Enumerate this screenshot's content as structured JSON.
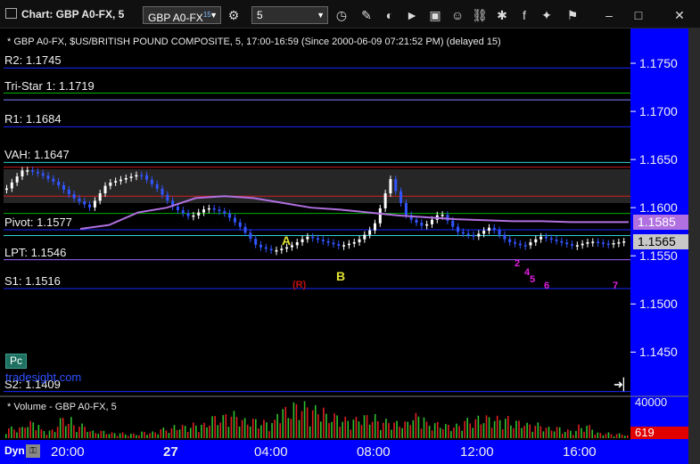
{
  "window": {
    "title": "Chart: GBP A0-FX, 5"
  },
  "toolbar": {
    "symbol": "GBP A0-FX",
    "symbol_sup": "15",
    "interval": "5"
  },
  "chart_header": "* GBP A0-FX, $US/BRITISH POUND COMPOSITE, 5, 17:00-16:59 (Since 2000-06-09 07:21:52 PM) (delayed 15)",
  "volume_header": "* Volume - GBP A0-FX, 5",
  "watermark": "tradesight.com",
  "pc_button": "Pc",
  "dyn_label": "Dyn",
  "colors": {
    "axis_bg": "#0000ff",
    "up": "#ffffff",
    "down": "#3355ff",
    "vwap": "#b070e0"
  },
  "chart_data": [
    {
      "type": "line",
      "ylim": [
        1.1405,
        1.1775
      ],
      "y_ticks": [
        "1.1750",
        "1.1700",
        "1.1650",
        "1.1600",
        "1.1550",
        "1.1500",
        "1.1450"
      ],
      "x_ticks": [
        "20:00",
        "27",
        "04:00",
        "08:00",
        "12:00",
        "16:00"
      ],
      "series": [
        {
          "values": [
            1.162,
            1.164,
            1.1635,
            1.1625,
            1.161,
            1.16,
            1.1625,
            1.163,
            1.1635,
            1.162,
            1.16,
            1.159,
            1.16,
            1.1595,
            1.158,
            1.156,
            1.1555,
            1.156,
            1.157,
            1.1565,
            1.156,
            1.1565,
            1.158,
            1.163,
            1.159,
            1.158,
            1.1595,
            1.1575,
            1.157,
            1.158,
            1.1565,
            1.156,
            1.157,
            1.1565,
            1.156,
            1.1565,
            1.1562,
            1.1565
          ]
        },
        {
          "values": [
            1.1578,
            1.1582,
            1.1595,
            1.16,
            1.161,
            1.1612,
            1.161,
            1.1605,
            1.16,
            1.1598,
            1.1595,
            1.1592,
            1.159,
            1.1588,
            1.1587,
            1.1586,
            1.1586,
            1.1585,
            1.1585,
            1.1585
          ]
        }
      ],
      "levels": [
        {
          "label": "R2: 1.1745",
          "value": 1.1745,
          "color": "#1a2aff"
        },
        {
          "label": "Tri-Star 1: 1.1719",
          "value": 1.1719,
          "color": "#00b000"
        },
        {
          "label": "",
          "value": 1.1712,
          "color": "#8080ff"
        },
        {
          "label": "R1: 1.1684",
          "value": 1.1684,
          "color": "#1a2aff"
        },
        {
          "label": "VAH: 1.1647",
          "value": 1.1647,
          "color": "#30d0d0"
        },
        {
          "label": "",
          "value": 1.1642,
          "color": "#d02020"
        },
        {
          "label": "",
          "value": 1.1612,
          "color": "#d02020"
        },
        {
          "label": "",
          "value": 1.1594,
          "color": "#00b000"
        },
        {
          "label": "Pivot: 1.1577",
          "value": 1.1577,
          "color": "#1a2aff"
        },
        {
          "label": "",
          "value": 1.1571,
          "color": "#30d0d0"
        },
        {
          "label": "LPT: 1.1546",
          "value": 1.1546,
          "color": "#a060ff"
        },
        {
          "label": "S1: 1.1516",
          "value": 1.1516,
          "color": "#1a2aff"
        },
        {
          "label": "S2: 1.1409",
          "value": 1.1409,
          "color": "#1a2aff"
        }
      ],
      "price_tags": [
        {
          "text": "1.1585",
          "value": 1.1585,
          "bg": "#b070e0",
          "fg": "#ffffff"
        },
        {
          "text": "1.1565",
          "value": 1.1565,
          "bg": "#c8c8c8",
          "fg": "#000000"
        }
      ],
      "annotations": [
        {
          "text": "A",
          "color": "#e0e030"
        },
        {
          "text": "B",
          "color": "#e0e030"
        },
        {
          "text": "(R)",
          "color": "#c01010"
        },
        {
          "text": "2",
          "color": "#e020e0"
        },
        {
          "text": "4",
          "color": "#e020e0"
        },
        {
          "text": "5",
          "color": "#e020e0"
        },
        {
          "text": "6",
          "color": "#e020e0"
        },
        {
          "text": "7",
          "color": "#e020e0"
        }
      ]
    },
    {
      "type": "bar",
      "y_ticks": [
        "40000"
      ],
      "last_value": "619",
      "values": [
        12000,
        18000,
        9000,
        22000,
        15000,
        8000,
        6000,
        5000,
        7000,
        11000,
        14000,
        16000,
        24000,
        28000,
        21000,
        19000,
        33000,
        38000,
        34000,
        26000,
        22000,
        25000,
        20000,
        18000,
        26000,
        17000,
        15000,
        21000,
        24000,
        23000,
        19000,
        16000,
        12000,
        9000,
        14000,
        6000,
        5000,
        3000
      ]
    }
  ]
}
